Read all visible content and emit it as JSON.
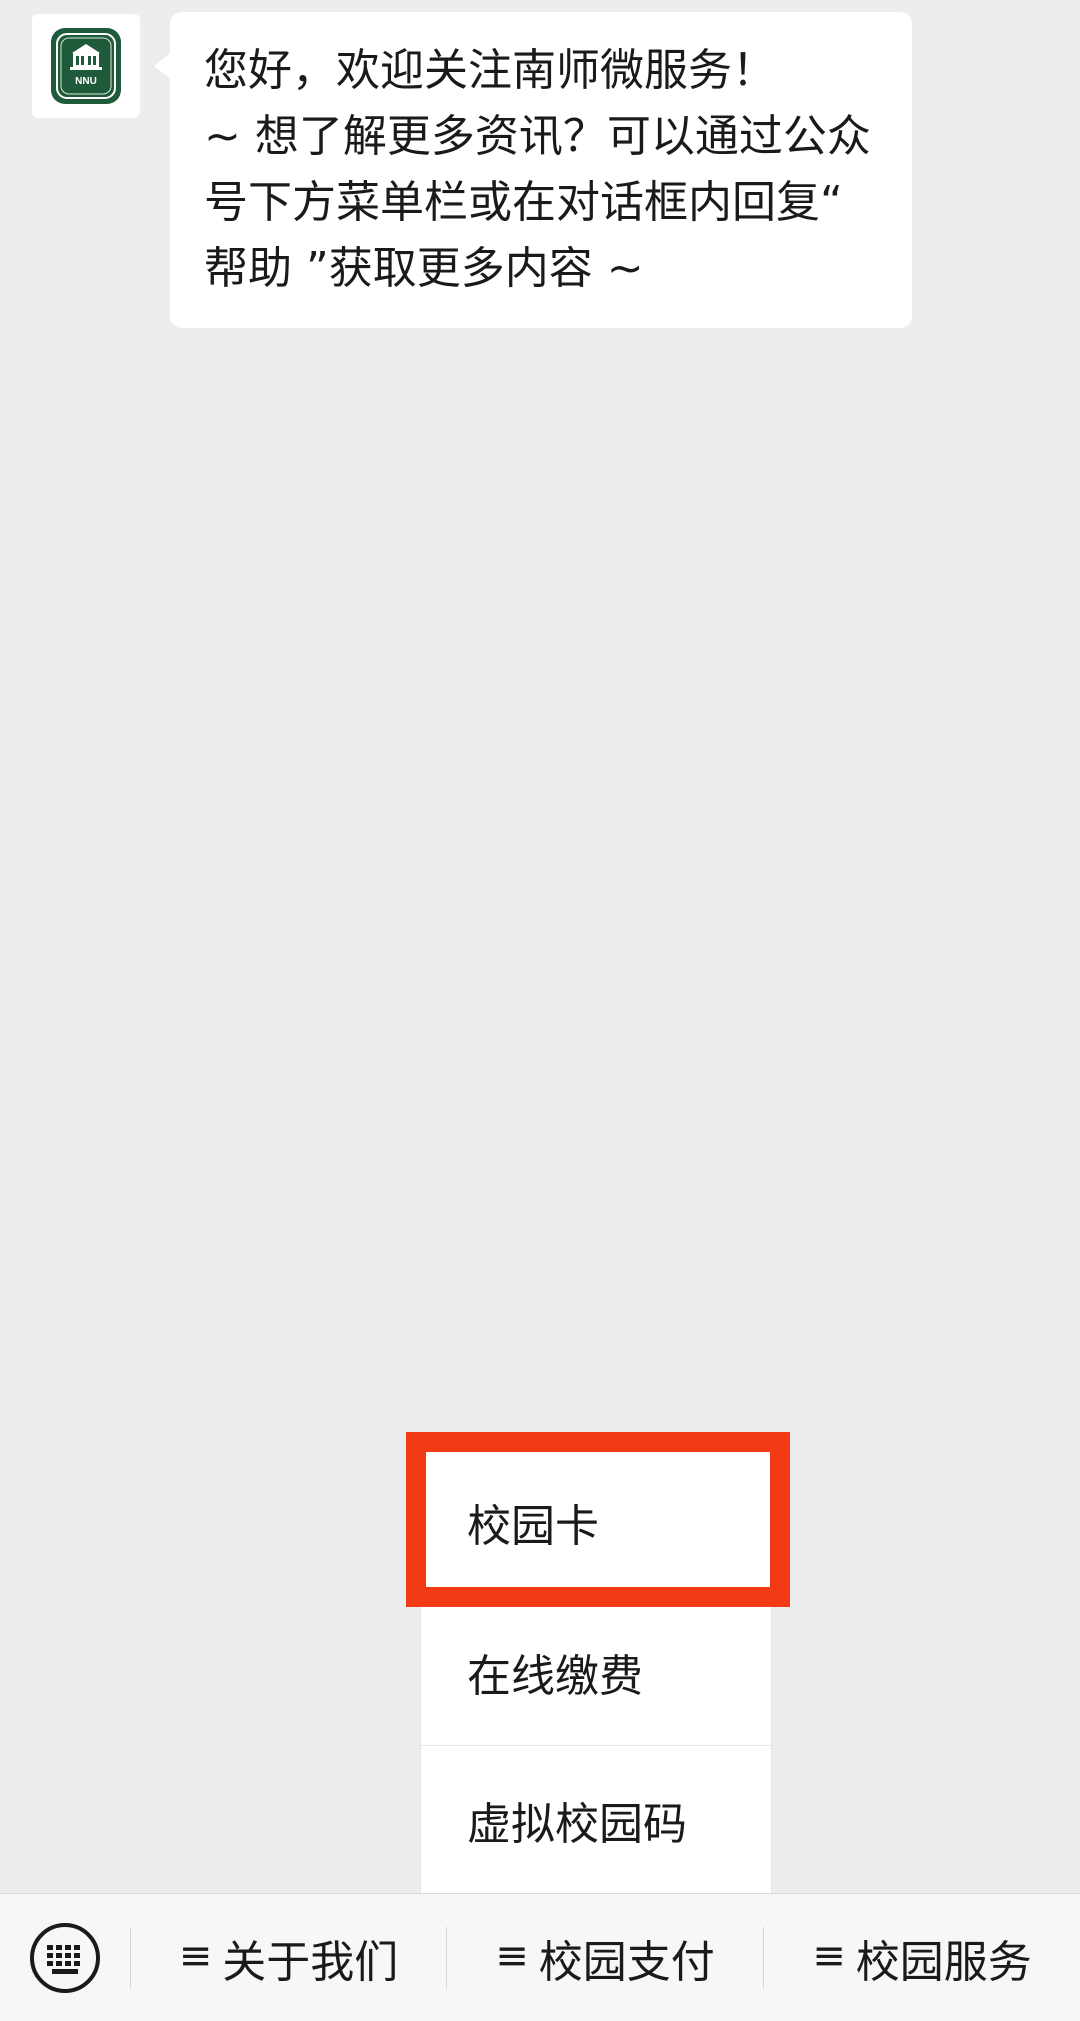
{
  "message": {
    "lines": [
      "您好，欢迎关注南师微服务！",
      "~ 想了解更多资讯？可以通过公众",
      "号下方菜单栏或在对话框内回复“",
      "帮助 ”获取更多内容 ~"
    ]
  },
  "avatar": {
    "logo_text": "NNU",
    "icon": "university-seal-icon"
  },
  "submenu": {
    "items": [
      "校园卡",
      "在线缴费",
      "虚拟校园码"
    ],
    "highlighted_index": 0,
    "highlight_color": "#f23a14"
  },
  "bottom_bar": {
    "keyboard_icon": "keyboard-icon",
    "menu_glyph": "≡",
    "items": [
      "关于我们",
      "校园支付",
      "校园服务"
    ]
  }
}
